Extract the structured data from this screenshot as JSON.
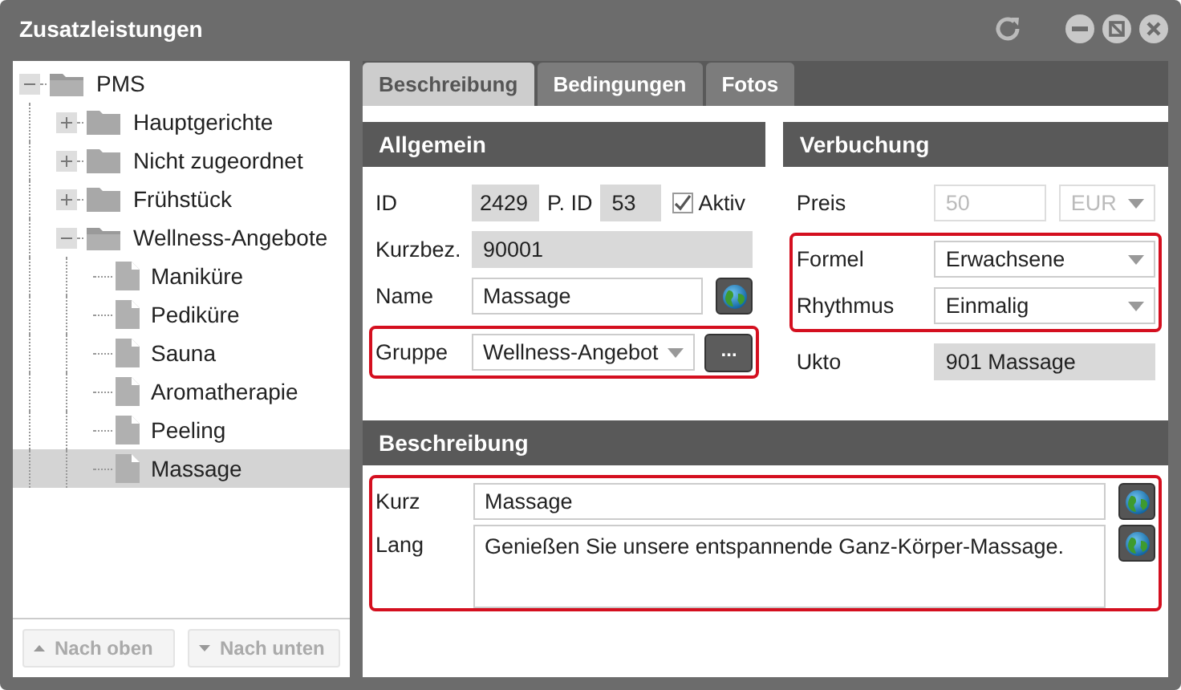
{
  "window": {
    "title": "Zusatzleistungen"
  },
  "tree": {
    "items": [
      {
        "label": "PMS",
        "kind": "folder",
        "expanded": true,
        "selected": false,
        "children": [
          {
            "label": "Hauptgerichte",
            "kind": "folder",
            "expanded": false,
            "selected": false
          },
          {
            "label": "Nicht zugeordnet",
            "kind": "folder",
            "expanded": false,
            "selected": false
          },
          {
            "label": "Frühstück",
            "kind": "folder",
            "expanded": false,
            "selected": false
          },
          {
            "label": "Wellness-Angebote",
            "kind": "folder",
            "expanded": true,
            "selected": false,
            "children": [
              {
                "label": "Maniküre",
                "kind": "page",
                "selected": false
              },
              {
                "label": "Pediküre",
                "kind": "page",
                "selected": false
              },
              {
                "label": "Sauna",
                "kind": "page",
                "selected": false
              },
              {
                "label": "Aromatherapie",
                "kind": "page",
                "selected": false
              },
              {
                "label": "Peeling",
                "kind": "page",
                "selected": false
              },
              {
                "label": "Massage",
                "kind": "page",
                "selected": true
              }
            ]
          }
        ]
      }
    ]
  },
  "tree_buttons": [
    {
      "label": "Nach oben",
      "kind": "up",
      "disabled": true
    },
    {
      "label": "Nach unten",
      "kind": "down",
      "disabled": true
    }
  ],
  "tabs": [
    {
      "label": "Beschreibung",
      "selected": true
    },
    {
      "label": "Bedingungen",
      "selected": false
    },
    {
      "label": "Fotos",
      "selected": false
    }
  ],
  "allgemein": {
    "title": "Allgemein",
    "groups": [
      {
        "highlighted": false,
        "rows": [
          {
            "kind": "ids",
            "label": "ID",
            "value": "2429",
            "label2": "P. ID",
            "value2": "53",
            "check": {
              "label": "Aktiv",
              "checked": true
            }
          },
          {
            "kind": "readonly",
            "label": "Kurzbez.",
            "value": "90001"
          },
          {
            "kind": "text",
            "label": "Name",
            "value": "Massage",
            "globe": true
          }
        ]
      },
      {
        "highlighted": true,
        "rows": [
          {
            "kind": "select",
            "label": "Gruppe",
            "value": "Wellness-Angebot",
            "more": "..."
          }
        ]
      }
    ]
  },
  "verbuchung": {
    "title": "Verbuchung",
    "groups": [
      {
        "highlighted": false,
        "rows": [
          {
            "kind": "price",
            "label": "Preis",
            "value": "50",
            "currency": "EUR",
            "disabled": true
          }
        ]
      },
      {
        "highlighted": true,
        "rows": [
          {
            "kind": "select",
            "label": "Formel",
            "value": "Erwachsene"
          },
          {
            "kind": "select",
            "label": "Rhythmus",
            "value": "Einmalig"
          }
        ]
      },
      {
        "highlighted": false,
        "rows": [
          {
            "kind": "readonly",
            "label": "Ukto",
            "value": "901 Massage"
          }
        ]
      }
    ]
  },
  "beschreibung": {
    "title": "Beschreibung",
    "groups": [
      {
        "highlighted": true,
        "rows": [
          {
            "kind": "text",
            "label": "Kurz",
            "value": "Massage",
            "globe": true
          },
          {
            "kind": "textarea",
            "label": "Lang",
            "value": "Genießen Sie unsere entspannende Ganz-Körper-Massage.",
            "globe": true
          }
        ]
      }
    ]
  }
}
